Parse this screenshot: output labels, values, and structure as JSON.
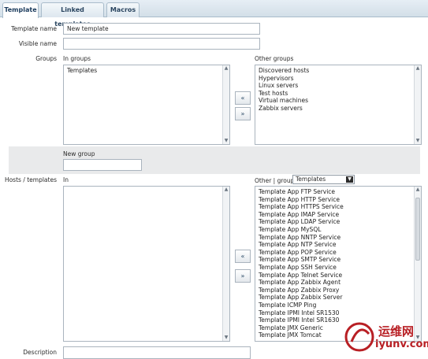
{
  "tabs": [
    {
      "label": "Template",
      "active": true
    },
    {
      "label": "Linked templates",
      "active": false
    },
    {
      "label": "Macros",
      "active": false
    }
  ],
  "form": {
    "template_name_label": "Template name",
    "template_name_value": "New template",
    "visible_name_label": "Visible name",
    "visible_name_value": "",
    "groups_label": "Groups",
    "in_groups_label": "In groups",
    "in_groups": [
      "Templates"
    ],
    "other_groups_label": "Other groups",
    "other_groups": [
      "Discovered hosts",
      "Hypervisors",
      "Linux servers",
      "Test hosts",
      "Virtual machines",
      "Zabbix servers"
    ],
    "add_group_button": "«",
    "remove_group_button": "»",
    "new_group_label": "New group",
    "new_group_value": "",
    "hosts_templates_label": "Hosts / templates",
    "in_label": "In",
    "other_group_label": "Other | group",
    "group_select_value": "Templates",
    "add_host_button": "«",
    "remove_host_button": "»",
    "other_hosts": [
      "Template App FTP Service",
      "Template App HTTP Service",
      "Template App HTTPS Service",
      "Template App IMAP Service",
      "Template App LDAP Service",
      "Template App MySQL",
      "Template App NNTP Service",
      "Template App NTP Service",
      "Template App POP Service",
      "Template App SMTP Service",
      "Template App SSH Service",
      "Template App Telnet Service",
      "Template App Zabbix Agent",
      "Template App Zabbix Proxy",
      "Template App Zabbix Server",
      "Template ICMP Ping",
      "Template IPMI Intel SR1530",
      "Template IPMI Intel SR1630",
      "Template JMX Generic",
      "Template JMX Tomcat"
    ],
    "description_label": "Description"
  },
  "watermark": {
    "text_cn": "运维网",
    "text_url": "iyunv.com",
    "color": "#b81f24"
  }
}
